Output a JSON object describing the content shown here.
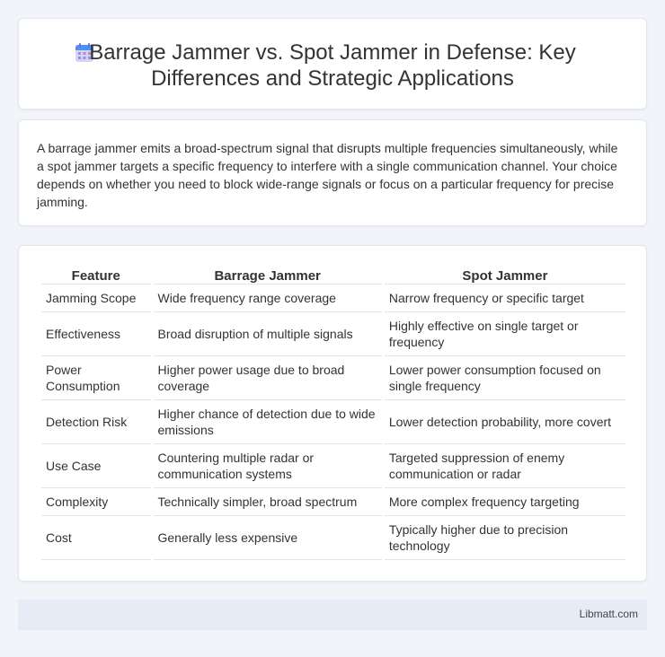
{
  "header": {
    "title": "Barrage Jammer vs. Spot Jammer in Defense: Key Differences and Strategic Applications",
    "icon": "calendar-icon"
  },
  "intro": {
    "text": "A barrage jammer emits a broad-spectrum signal that disrupts multiple frequencies simultaneously, while a spot jammer targets a specific frequency to interfere with a single communication channel. Your choice depends on whether you need to block wide-range signals or focus on a particular frequency for precise jamming."
  },
  "table": {
    "headers": [
      "Feature",
      "Barrage Jammer",
      "Spot Jammer"
    ],
    "rows": [
      [
        "Jamming Scope",
        "Wide frequency range coverage",
        "Narrow frequency or specific target"
      ],
      [
        "Effectiveness",
        "Broad disruption of multiple signals",
        "Highly effective on single target or frequency"
      ],
      [
        "Power Consumption",
        "Higher power usage due to broad coverage",
        "Lower power consumption focused on single frequency"
      ],
      [
        "Detection Risk",
        "Higher chance of detection due to wide emissions",
        "Lower detection probability, more covert"
      ],
      [
        "Use Case",
        "Countering multiple radar or communication systems",
        "Targeted suppression of enemy communication or radar"
      ],
      [
        "Complexity",
        "Technically simpler, broad spectrum",
        "More complex frequency targeting"
      ],
      [
        "Cost",
        "Generally less expensive",
        "Typically higher due to precision technology"
      ]
    ]
  },
  "footer": {
    "text": "Libmatt.com"
  }
}
